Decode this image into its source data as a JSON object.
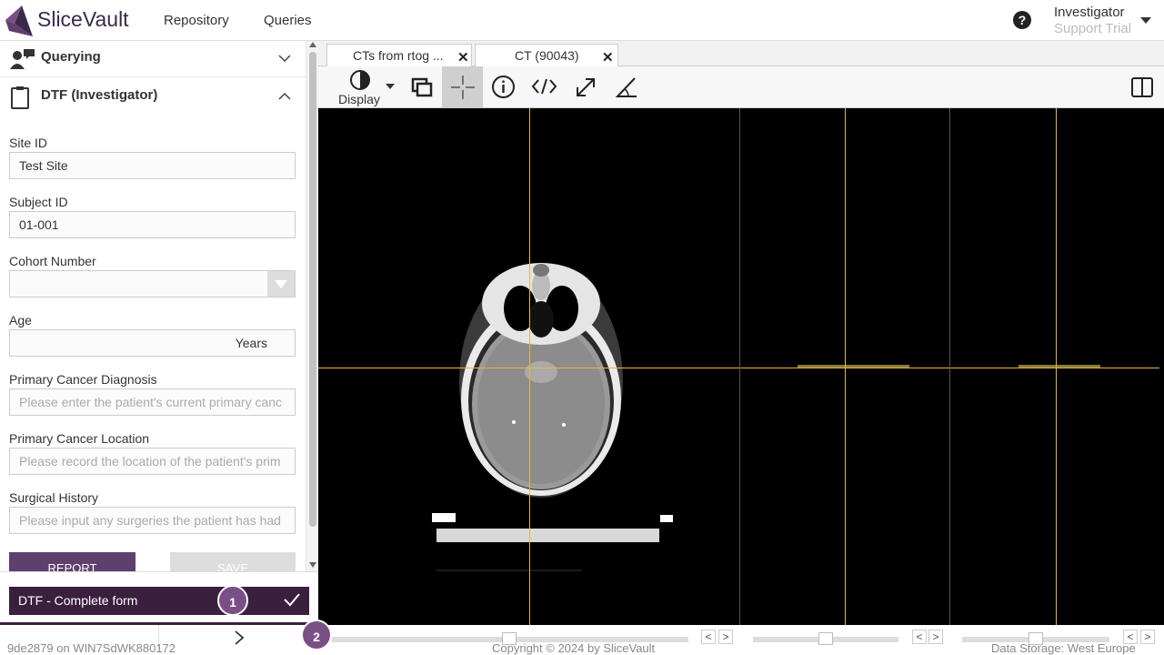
{
  "app": {
    "name": "SliceVault",
    "nav": [
      "Repository",
      "Queries"
    ]
  },
  "user": {
    "name": "Investigator",
    "trial": "Support Trial"
  },
  "sidebar": {
    "sections": [
      {
        "title": "Querying",
        "icon": "user-chat-icon",
        "state": "collapsed"
      },
      {
        "title": "DTF (Investigator)",
        "icon": "clipboard-icon",
        "state": "expanded"
      }
    ],
    "fields": {
      "site_id": {
        "label": "Site ID",
        "value": "Test Site"
      },
      "subject_id": {
        "label": "Subject ID",
        "value": "01-001"
      },
      "cohort": {
        "label": "Cohort Number",
        "value": ""
      },
      "age": {
        "label": "Age",
        "unit": "Years",
        "value": ""
      },
      "diagnosis": {
        "label": "Primary Cancer Diagnosis",
        "placeholder": "Please enter the patient's current primary canc"
      },
      "location": {
        "label": "Primary Cancer Location",
        "placeholder": "Please record the location of the patient's prim"
      },
      "surgical": {
        "label": "Surgical History",
        "placeholder": "Please input any surgeries the patient has had"
      }
    },
    "buttons": {
      "report": "REPORT",
      "save": "SAVE"
    }
  },
  "task": {
    "label": "DTF - Complete form",
    "badge1": "1",
    "badge2": "2"
  },
  "footer": {
    "left": "9de2879 on WIN7SdWK880172",
    "center": "Copyright © 2024 by SliceVault",
    "right": "Data Storage: West Europe"
  },
  "viewer": {
    "tabs": [
      {
        "label": "CTs from rtog ...",
        "active": false
      },
      {
        "label": "CT (90043)",
        "active": true
      }
    ],
    "toolbar": {
      "display_label": "Display",
      "tools": [
        "contrast-icon",
        "windows-icon",
        "crosshair-icon",
        "info-icon",
        "code-icon",
        "expand-icon",
        "angle-icon",
        "split-view-icon"
      ]
    },
    "crosshair_color": "#e8b73a",
    "nav_prev": "<",
    "nav_next": ">"
  },
  "colors": {
    "brand": "#5e3f6e",
    "task_bar": "#3a1f3f",
    "badge": "#7a4f86"
  }
}
